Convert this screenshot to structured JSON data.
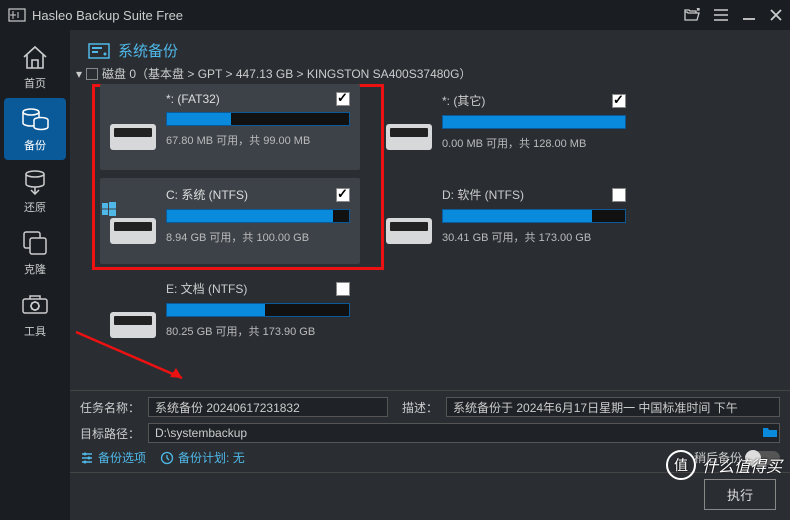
{
  "titlebar": {
    "app_name": "Hasleo Backup Suite Free"
  },
  "sidebar": {
    "items": [
      {
        "label": "首页"
      },
      {
        "label": "备份"
      },
      {
        "label": "还原"
      },
      {
        "label": "克隆"
      },
      {
        "label": "工具"
      }
    ]
  },
  "page": {
    "title": "系统备份"
  },
  "disk": {
    "name": "磁盘 0（基本盘 > GPT > 447.13 GB > KINGSTON SA400S37480G）"
  },
  "partitions": [
    {
      "name": "*: (FAT32)",
      "usage_text": "67.80 MB 可用，共 99.00 MB",
      "fill": 35,
      "checked": true,
      "highlighted": true,
      "win": false
    },
    {
      "name": "*: (其它)",
      "usage_text": "0.00 MB 可用，共 128.00 MB",
      "fill": 100,
      "checked": true,
      "highlighted": false,
      "win": false,
      "unboxed": true
    },
    {
      "name": "C: 系统 (NTFS)",
      "usage_text": "8.94 GB 可用，共 100.00 GB",
      "fill": 91,
      "checked": true,
      "highlighted": true,
      "win": true
    },
    {
      "name": "D: 软件 (NTFS)",
      "usage_text": "30.41 GB 可用，共 173.00 GB",
      "fill": 82,
      "checked": false,
      "highlighted": false,
      "win": false,
      "unboxed": true
    },
    {
      "name": "E: 文档 (NTFS)",
      "usage_text": "80.25 GB 可用，共 173.90 GB",
      "fill": 54,
      "checked": false,
      "highlighted": false,
      "win": false,
      "unboxed": true
    }
  ],
  "form": {
    "task_label": "任务名称：",
    "task_value": "系统备份 20240617231832",
    "desc_label": "描述：",
    "desc_value": "系统备份于 2024年6月17日星期一 中国标准时间 下午",
    "path_label": "目标路径：",
    "path_value": "D:\\systembackup"
  },
  "links": {
    "options": "备份选项",
    "plan_label": "备份计划:",
    "plan_value": "无",
    "later": "稍后备份"
  },
  "action": {
    "execute": "执行"
  },
  "watermark": {
    "char": "值",
    "text": "什么值得买"
  }
}
